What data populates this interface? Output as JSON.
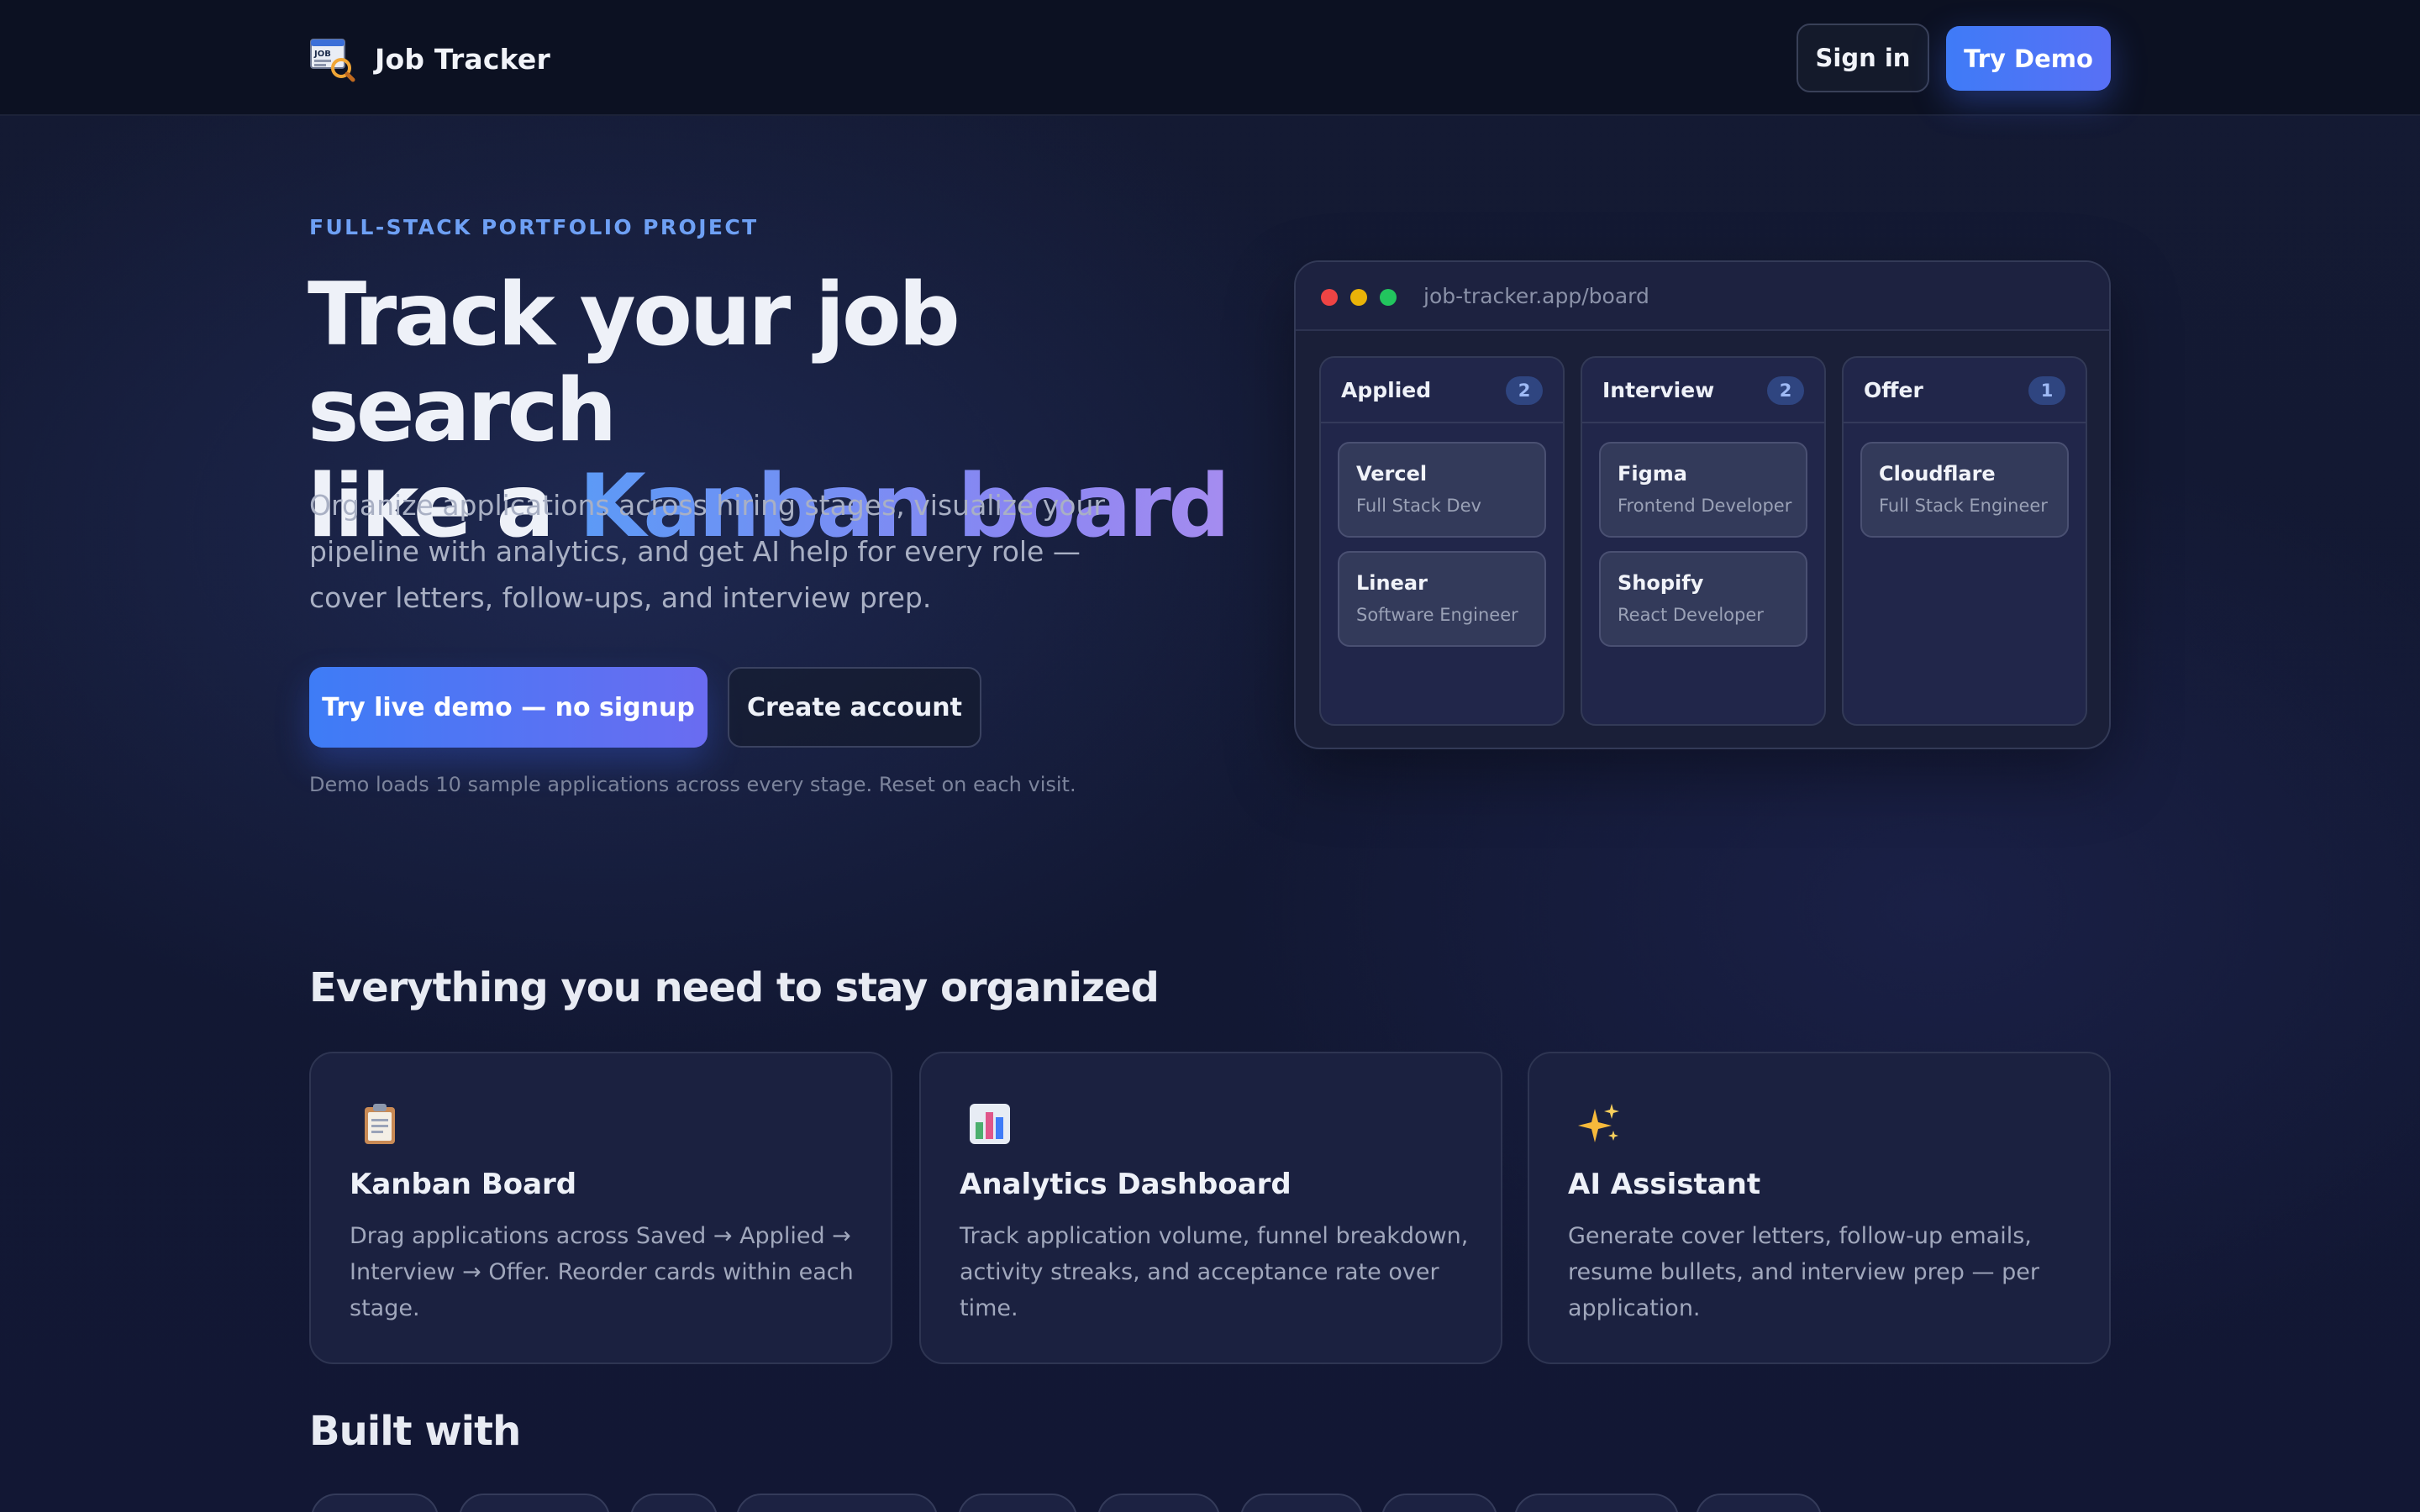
{
  "header": {
    "brand_name": "Job Tracker",
    "logo_icon": "job-search-icon",
    "sign_in_label": "Sign in",
    "try_demo_label": "Try Demo"
  },
  "hero": {
    "eyebrow": "FULL-STACK PORTFOLIO PROJECT",
    "title_line1": "Track your job search",
    "title_line2_prefix": "like a ",
    "title_line2_highlight": "Kanban board",
    "subtitle": "Organize applications across hiring stages, visualize your pipeline with analytics, and get AI help for every role — cover letters, follow-ups, and interview prep.",
    "primary_cta": "Try live demo — no signup",
    "secondary_cta": "Create account",
    "demo_note": "Demo loads 10 sample applications across every stage. Reset on each visit."
  },
  "board_preview": {
    "url": "job-tracker.app/board",
    "columns": [
      {
        "title": "Applied",
        "count": "2",
        "cards": [
          {
            "company": "Vercel",
            "role": "Full Stack Dev"
          },
          {
            "company": "Linear",
            "role": "Software Engineer"
          }
        ]
      },
      {
        "title": "Interview",
        "count": "2",
        "cards": [
          {
            "company": "Figma",
            "role": "Frontend Developer"
          },
          {
            "company": "Shopify",
            "role": "React Developer"
          }
        ]
      },
      {
        "title": "Offer",
        "count": "1",
        "cards": [
          {
            "company": "Cloudflare",
            "role": "Full Stack Engineer"
          }
        ]
      }
    ]
  },
  "features": {
    "section_title": "Everything you need to stay organized",
    "items": [
      {
        "icon": "clipboard-icon",
        "title": "Kanban Board",
        "description": "Drag applications across Saved → Applied → Interview → Offer. Reorder cards within each stage."
      },
      {
        "icon": "bar-chart-icon",
        "title": "Analytics Dashboard",
        "description": "Track application volume, funnel breakdown, activity streaks, and acceptance rate over time."
      },
      {
        "icon": "sparkles-icon",
        "title": "AI Assistant",
        "description": "Generate cover letters, follow-up emails, resume bullets, and interview prep — per application."
      }
    ]
  },
  "built_with": {
    "section_title": "Built with"
  },
  "colors": {
    "accent_blue": "#3f7bf7",
    "accent_violet": "#8b86f2",
    "eyebrow": "#6ea0f4",
    "count_badge": "#2f4580"
  }
}
